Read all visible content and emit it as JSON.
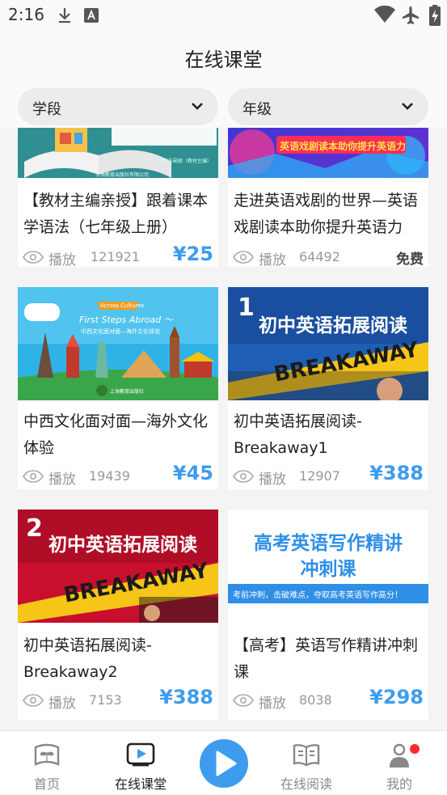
{
  "status_bar": {
    "time": "2:16",
    "icons": [
      "download-icon",
      "font-icon",
      "wifi-icon",
      "airplane-icon",
      "battery-charging-icon"
    ]
  },
  "header": {
    "title": "在线课堂"
  },
  "filters": [
    {
      "label": "学段",
      "icon": "chevron-down-icon"
    },
    {
      "label": "年级",
      "icon": "chevron-down-icon"
    }
  ],
  "courses": [
    {
      "title": "【教材主编亲授】跟着课本学语法（七年级上册）",
      "play_label": "播放",
      "plays": "121921",
      "price": "¥25",
      "thumb": {
        "publisher": "上海教育出版社有限公司",
        "author": "主讲人：李绪东副部（教材主编）"
      }
    },
    {
      "title": "走进英语戏剧的世界—英语戏剧读本助你提升英语力",
      "play_label": "播放",
      "plays": "64492",
      "price": "免费",
      "thumb": {
        "banner": "英语戏剧读本助你提升英语力"
      }
    },
    {
      "title": "中西文化面对面—海外文化体验",
      "play_label": "播放",
      "plays": "19439",
      "price": "¥45",
      "thumb": {
        "ribbon": "Across Cultures",
        "headline": "First Steps Abroad ～",
        "subtitle": "中西文化面对面—海外文化体验",
        "publisher": "上海教育出版社"
      }
    },
    {
      "title": "初中英语拓展阅读-Breakaway1",
      "play_label": "播放",
      "plays": "12907",
      "price": "¥388",
      "thumb": {
        "number": "1",
        "headline": "初中英语拓展阅读",
        "brand": "BREAKAWAY"
      }
    },
    {
      "title": "初中英语拓展阅读-Breakaway2",
      "play_label": "播放",
      "plays": "7153",
      "price": "¥388",
      "thumb": {
        "number": "2",
        "headline": "初中英语拓展阅读",
        "brand": "BREAKAWAY"
      }
    },
    {
      "title": "【高考】英语写作精讲冲刺课",
      "play_label": "播放",
      "plays": "8038",
      "price": "¥298",
      "thumb": {
        "line1": "高考英语写作精讲",
        "line2": "冲刺课",
        "tagline": "考前冲刺，击破难点，夺取高考英语写作高分！"
      }
    }
  ],
  "bottom_nav": [
    {
      "label": "首页",
      "icon": "home-book-icon"
    },
    {
      "label": "在线课堂",
      "icon": "video-play-icon",
      "active": true
    },
    {
      "label": "",
      "icon": "play-circle-icon"
    },
    {
      "label": "在线阅读",
      "icon": "open-book-icon"
    },
    {
      "label": "我的",
      "icon": "user-icon",
      "badge": "red-dot"
    }
  ],
  "colors": {
    "accent": "#3e9cee",
    "badge": "#ff2d2d",
    "background": "#f4f4f4"
  }
}
